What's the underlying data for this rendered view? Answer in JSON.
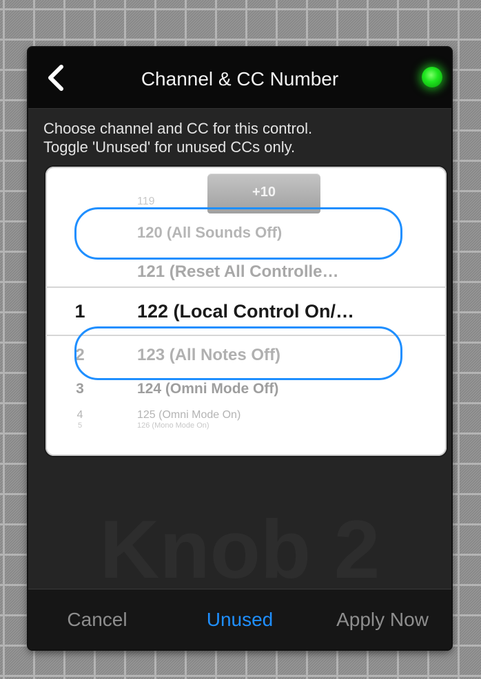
{
  "header": {
    "title": "Channel & CC Number",
    "back_icon": "chevron-left-icon",
    "status_color": "#22e822"
  },
  "description": {
    "line1": "Choose channel and CC for this control.",
    "line2": "Toggle 'Unused' for unused CCs only."
  },
  "background_label": "Knob 2",
  "picker": {
    "increment_button": "+10",
    "rows": [
      {
        "channel": "",
        "cc": "119"
      },
      {
        "channel": "",
        "cc": "120 (All Sounds Off)"
      },
      {
        "channel": "",
        "cc": "121 (Reset All Controlle…"
      },
      {
        "channel": "1",
        "cc": "122 (Local Control On/…"
      },
      {
        "channel": "2",
        "cc": "123 (All Notes Off)"
      },
      {
        "channel": "3",
        "cc": "124 (Omni Mode Off)"
      },
      {
        "channel": "4",
        "cc": "125 (Omni Mode On)"
      },
      {
        "channel": "5",
        "cc": "126 (Mono Mode On)"
      }
    ]
  },
  "footer": {
    "cancel": "Cancel",
    "unused": "Unused",
    "apply": "Apply Now"
  },
  "colors": {
    "accent": "#1f8fff",
    "highlight_ring": "#1f8fff",
    "dialog_bg": "#252525",
    "header_bg": "#0a0a0a"
  }
}
